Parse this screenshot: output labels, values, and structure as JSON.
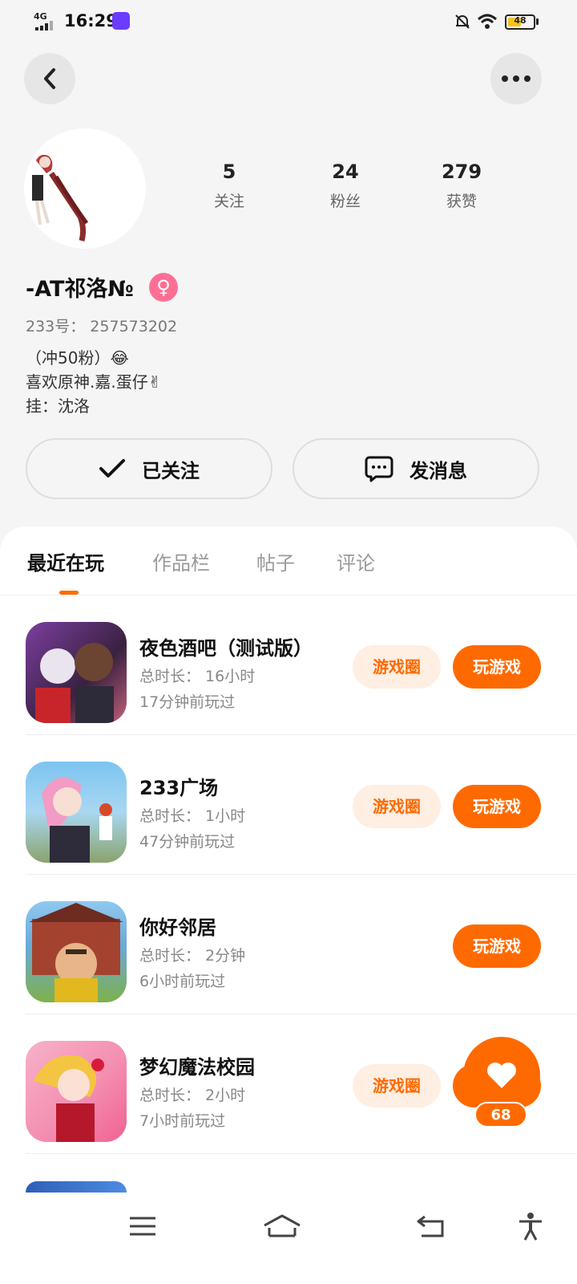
{
  "status_bar": {
    "network": "4G",
    "time": "16:29",
    "battery": "48"
  },
  "profile": {
    "stats": [
      {
        "value": "5",
        "label": "关注"
      },
      {
        "value": "24",
        "label": "粉丝"
      },
      {
        "value": "279",
        "label": "获赞"
      }
    ],
    "nickname": "-AT祁洛№",
    "gender_symbol": "♀",
    "uid_label": "233号： 257573202",
    "bio_lines": [
      "（冲50粉）😂",
      "喜欢原神.嘉.蛋仔✌",
      "挂：沈洛"
    ]
  },
  "actions": {
    "follow_label": "已关注",
    "message_label": "发消息"
  },
  "tabs": [
    "最近在玩",
    "作品栏",
    "帖子",
    "评论"
  ],
  "games": [
    {
      "name": "夜色酒吧（测试版）",
      "duration": "总时长： 16小时",
      "last_played": "17分钟前玩过",
      "circle_label": "游戏圈",
      "play_label": "玩游戏"
    },
    {
      "name": "233广场",
      "duration": "总时长： 1小时",
      "last_played": "47分钟前玩过",
      "circle_label": "游戏圈",
      "play_label": "玩游戏"
    },
    {
      "name": "你好邻居",
      "duration": "总时长： 2分钟",
      "last_played": "6小时前玩过",
      "circle_label": "",
      "play_label": "玩游戏"
    },
    {
      "name": "梦幻魔法校园",
      "duration": "总时长： 2小时",
      "last_played": "7小时前玩过",
      "circle_label": "游戏圈",
      "play_label": "玩游戏"
    }
  ],
  "like_count": "68",
  "colors": {
    "accent": "#ff6a00",
    "accent_light": "#ffeee2",
    "background": "#f5f5f5"
  }
}
